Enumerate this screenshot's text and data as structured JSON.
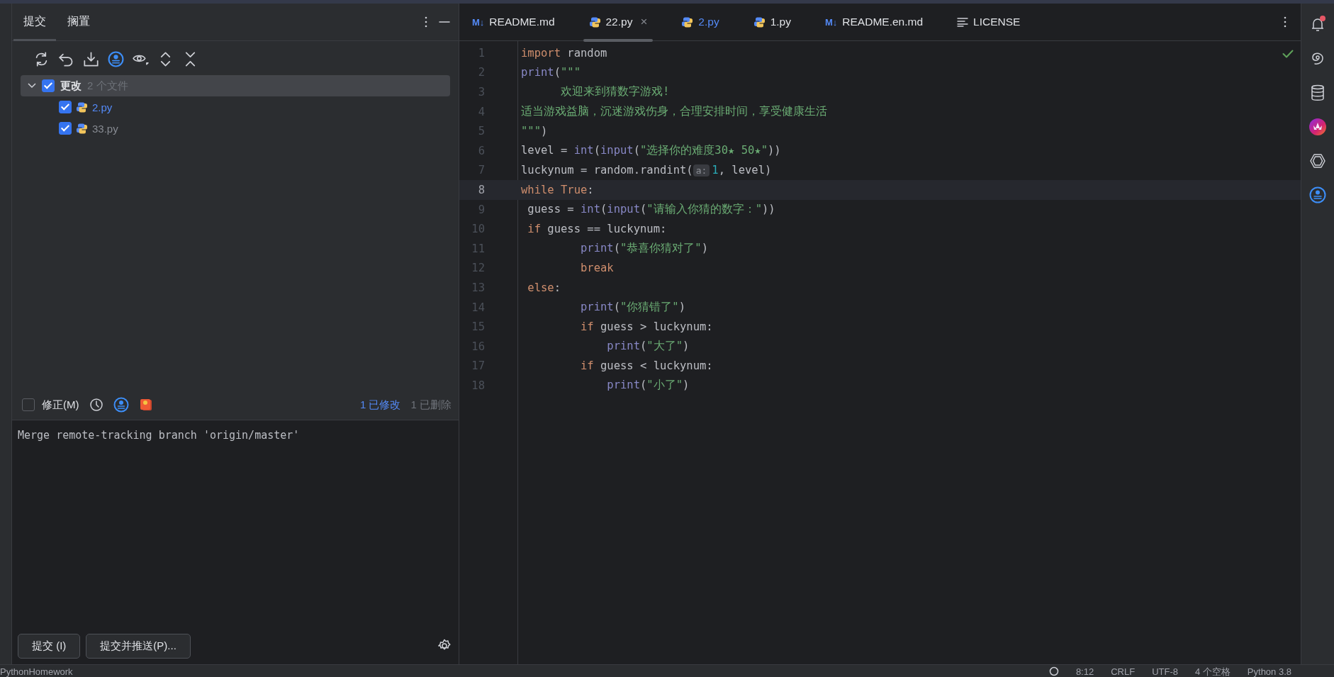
{
  "commit_panel": {
    "tabs": [
      {
        "label": "提交",
        "selected": true
      },
      {
        "label": "搁置",
        "selected": false
      }
    ],
    "changes": {
      "label": "更改",
      "count": "2 个文件",
      "checked": true,
      "expanded": true,
      "children": [
        {
          "name": "2.py",
          "modified": true,
          "checked": true
        },
        {
          "name": "33.py",
          "modified": false,
          "checked": true
        }
      ]
    },
    "amend": {
      "label": "修正(M)",
      "checked": false
    },
    "stats": [
      {
        "text": "1 已修改",
        "kind": "modified"
      },
      {
        "text": "1 已删除",
        "kind": "deleted"
      }
    ],
    "message": "Merge remote-tracking branch 'origin/master'",
    "buttons": [
      "提交 (I)",
      "提交并推送(P)..."
    ]
  },
  "editor": {
    "tabs": [
      {
        "label": "README.md",
        "kind": "markdown",
        "badge": "M↓",
        "selected": false,
        "modified": false
      },
      {
        "label": "22.py",
        "kind": "python",
        "selected": true,
        "modified": false,
        "close": "×"
      },
      {
        "label": "2.py",
        "kind": "python",
        "selected": false,
        "modified": true
      },
      {
        "label": "1.py",
        "kind": "python",
        "selected": false,
        "modified": false
      },
      {
        "label": "README.en.md",
        "kind": "markdown",
        "badge": "M↓",
        "selected": false,
        "modified": false
      },
      {
        "label": "LICENSE",
        "kind": "text",
        "selected": false,
        "modified": false
      }
    ],
    "lines": [
      {
        "n": "1",
        "current": false,
        "tokens": [
          {
            "t": "import",
            "kind": "kw"
          },
          {
            "t": " random",
            "kind": "id"
          }
        ]
      },
      {
        "n": "2",
        "current": false,
        "tokens": [
          {
            "t": "print",
            "kind": "fn"
          },
          {
            "t": "(",
            "kind": "id"
          },
          {
            "t": "\"\"\"",
            "kind": "str"
          }
        ]
      },
      {
        "n": "3",
        "current": false,
        "tokens": [
          {
            "t": "      欢迎来到猜数字游戏!",
            "kind": "str"
          }
        ]
      },
      {
        "n": "4",
        "current": false,
        "tokens": [
          {
            "t": "适当游戏益脑，沉迷游戏伤身，合理安排时间，享受健康生活",
            "kind": "str"
          }
        ]
      },
      {
        "n": "5",
        "current": false,
        "tokens": [
          {
            "t": "\"\"\"",
            "kind": "str"
          },
          {
            "t": ")",
            "kind": "id"
          }
        ]
      },
      {
        "n": "6",
        "current": false,
        "tokens": [
          {
            "t": "level = ",
            "kind": "id"
          },
          {
            "t": "int",
            "kind": "fn"
          },
          {
            "t": "(",
            "kind": "id"
          },
          {
            "t": "input",
            "kind": "fn"
          },
          {
            "t": "(",
            "kind": "id"
          },
          {
            "t": "\"选择你的难度30★ 50★\"",
            "kind": "str"
          },
          {
            "t": "))",
            "kind": "id"
          }
        ]
      },
      {
        "n": "7",
        "current": false,
        "tokens": [
          {
            "t": "luckynum = random.randint(",
            "kind": "id"
          },
          {
            "t": "a:",
            "kind": "hint"
          },
          {
            "t": "1",
            "kind": "num"
          },
          {
            "t": ", level)",
            "kind": "id"
          }
        ]
      },
      {
        "n": "8",
        "current": true,
        "tokens": [
          {
            "t": "while",
            "kind": "kw"
          },
          {
            "t": " True",
            "kind": "kw"
          },
          {
            "t": ":",
            "kind": "id"
          }
        ]
      },
      {
        "n": "9",
        "current": false,
        "tokens": [
          {
            "t": " guess = ",
            "kind": "id"
          },
          {
            "t": "int",
            "kind": "fn"
          },
          {
            "t": "(",
            "kind": "id"
          },
          {
            "t": "input",
            "kind": "fn"
          },
          {
            "t": "(",
            "kind": "id"
          },
          {
            "t": "\"请输入你猜的数字：\"",
            "kind": "str"
          },
          {
            "t": "))",
            "kind": "id"
          }
        ]
      },
      {
        "n": "10",
        "current": false,
        "tokens": [
          {
            "t": " if",
            "kind": "kw"
          },
          {
            "t": " guess == luckynum:",
            "kind": "id"
          }
        ]
      },
      {
        "n": "11",
        "current": false,
        "tokens": [
          {
            "t": "         print",
            "kind": "fn"
          },
          {
            "t": "(",
            "kind": "id"
          },
          {
            "t": "\"恭喜你猜对了\"",
            "kind": "str"
          },
          {
            "t": ")",
            "kind": "id"
          }
        ]
      },
      {
        "n": "12",
        "current": false,
        "tokens": [
          {
            "t": "         break",
            "kind": "kw"
          }
        ]
      },
      {
        "n": "13",
        "current": false,
        "tokens": [
          {
            "t": " else",
            "kind": "kw"
          },
          {
            "t": ":",
            "kind": "id"
          }
        ]
      },
      {
        "n": "14",
        "current": false,
        "tokens": [
          {
            "t": "         print",
            "kind": "fn"
          },
          {
            "t": "(",
            "kind": "id"
          },
          {
            "t": "\"你猜错了\"",
            "kind": "str"
          },
          {
            "t": ")",
            "kind": "id"
          }
        ]
      },
      {
        "n": "15",
        "current": false,
        "tokens": [
          {
            "t": "         if",
            "kind": "kw"
          },
          {
            "t": " guess > luckynum:",
            "kind": "id"
          }
        ]
      },
      {
        "n": "16",
        "current": false,
        "tokens": [
          {
            "t": "             print",
            "kind": "fn"
          },
          {
            "t": "(",
            "kind": "id"
          },
          {
            "t": "\"大了\"",
            "kind": "str"
          },
          {
            "t": ")",
            "kind": "id"
          }
        ]
      },
      {
        "n": "17",
        "current": false,
        "tokens": [
          {
            "t": "         if",
            "kind": "kw"
          },
          {
            "t": " guess < luckynum:",
            "kind": "id"
          }
        ]
      },
      {
        "n": "18",
        "current": false,
        "tokens": [
          {
            "t": "             print",
            "kind": "fn"
          },
          {
            "t": "(",
            "kind": "id"
          },
          {
            "t": "\"小了\"",
            "kind": "str"
          },
          {
            "t": ")",
            "kind": "id"
          }
        ]
      }
    ]
  },
  "status_bar": {
    "project": "PythonHomework",
    "items": [
      "8:12",
      "CRLF",
      "UTF-8",
      "4 个空格",
      "Python 3.8"
    ]
  }
}
